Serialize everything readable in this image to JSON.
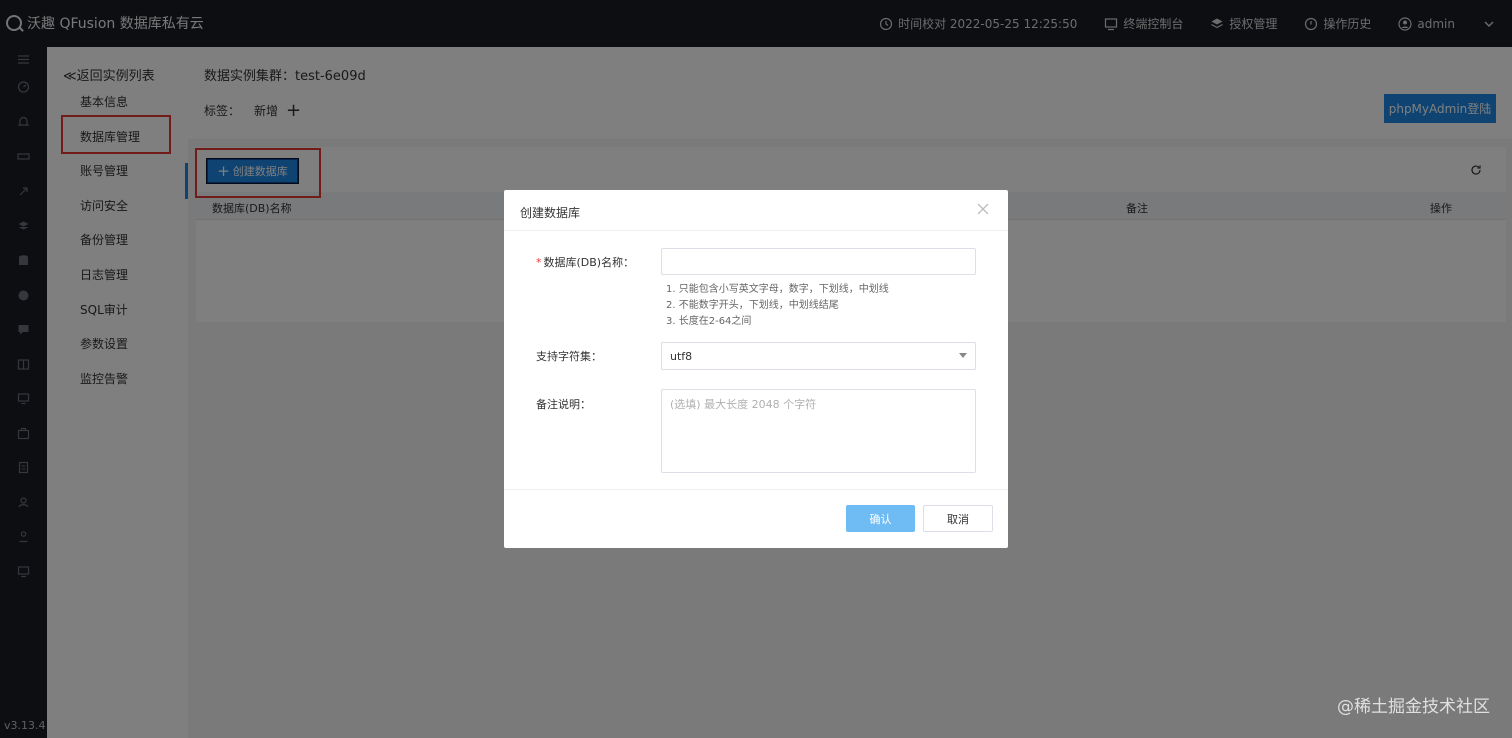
{
  "app": {
    "title": "沃趣 QFusion 数据库私有云",
    "version": "v3.13.4"
  },
  "topnav": {
    "time_check": "时间校对 2022-05-25 12:25:50",
    "terminal": "终端控制台",
    "license": "授权管理",
    "history": "操作历史",
    "user": "admin"
  },
  "subnav": {
    "back": "≪返回实例列表",
    "items": [
      "基本信息",
      "数据库管理",
      "账号管理",
      "访问安全",
      "备份管理",
      "日志管理",
      "SQL审计",
      "参数设置",
      "监控告警"
    ],
    "active": "数据库管理"
  },
  "header": {
    "cluster": "数据实例集群：test-6e09d",
    "tag_label": "标签：",
    "tag_new": "新增",
    "tag_add": "+",
    "phpmyadmin": "phpMyAdmin登陆"
  },
  "panel": {
    "create_button": "创建数据库",
    "columns": [
      "数据库(DB)名称",
      "备注",
      "操作"
    ]
  },
  "dialog": {
    "title": "创建数据库",
    "name_label": "数据库(DB)名称：",
    "name_value": "",
    "hints": [
      "1. 只能包含小写英文字母，数字，下划线，中划线",
      "2. 不能数字开头，下划线，中划线结尾",
      "3. 长度在2-64之间"
    ],
    "charset_label": "支持字符集：",
    "charset_value": "utf8",
    "remark_label": "备注说明：",
    "remark_placeholder": "(选填) 最大长度 2048 个字符",
    "confirm": "确认",
    "cancel": "取消"
  },
  "watermark": "@稀土掘金技术社区",
  "colors": {
    "sidebar_dark": "#1b1d24",
    "primary": "#1e88e5",
    "confirm_disabled": "#6fbbf3",
    "highlight_red": "#e53935",
    "required": "#e53935"
  }
}
